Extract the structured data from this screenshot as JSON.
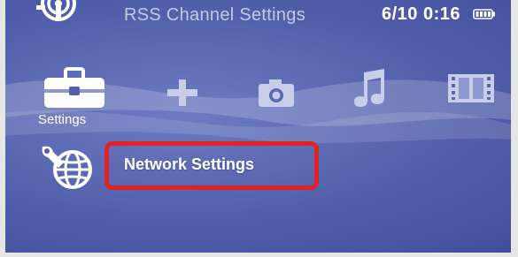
{
  "status_bar": {
    "title": "RSS Channel Settings",
    "datetime": "6/10 0:16",
    "battery_icon": "battery-icon"
  },
  "category_bar": {
    "items": [
      {
        "name": "Settings",
        "icon": "toolbox-icon",
        "selected": true
      },
      {
        "name": "",
        "icon": "plus-icon"
      },
      {
        "name": "",
        "icon": "camera-icon"
      },
      {
        "name": "",
        "icon": "music-note-icon"
      },
      {
        "name": "",
        "icon": "film-strip-icon"
      }
    ],
    "selected_label": "Settings"
  },
  "menu": {
    "selected_item": {
      "label": "Network Settings",
      "icon": "network-globe-icon"
    },
    "highlight_color": "#e02424"
  },
  "colors": {
    "background": "#5260ab",
    "text": "#ffffff",
    "dim_text": "#c3c8e6"
  }
}
